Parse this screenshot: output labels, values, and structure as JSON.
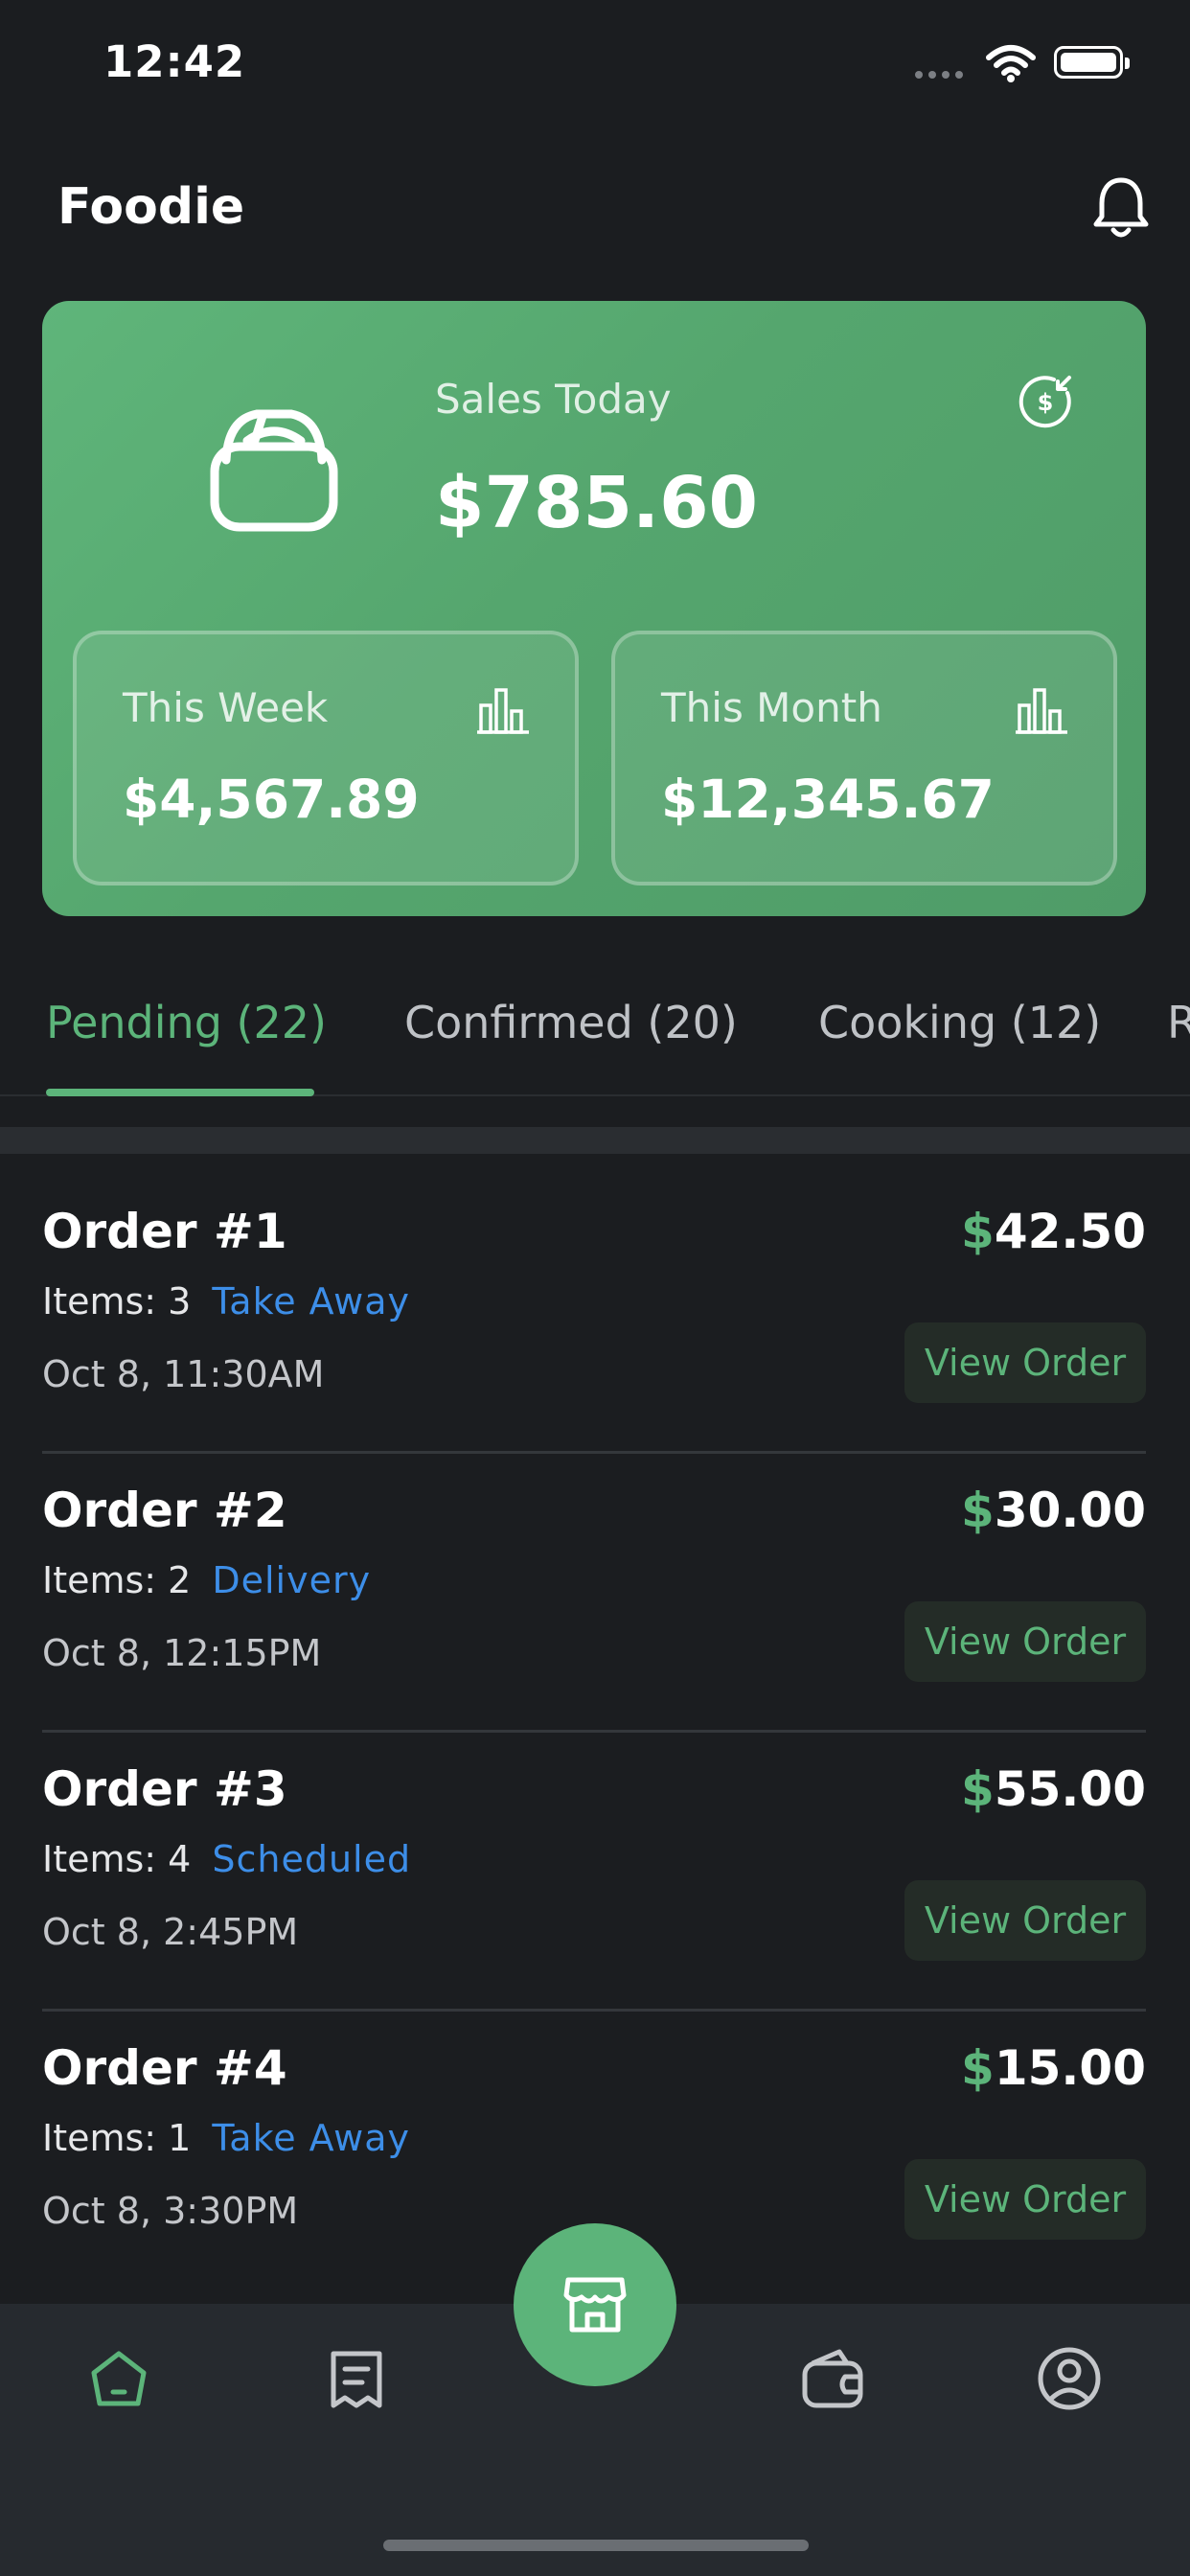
{
  "status_bar": {
    "time": "12:42"
  },
  "header": {
    "title": "Foodie"
  },
  "hero": {
    "sales_label": "Sales Today",
    "sales_value": "$785.60",
    "stats": [
      {
        "label": "This Week",
        "value": "$4,567.89"
      },
      {
        "label": "This Month",
        "value": "$12,345.67"
      }
    ]
  },
  "tabs": [
    {
      "label": "Pending (22)",
      "active": true
    },
    {
      "label": "Confirmed (20)"
    },
    {
      "label": "Cooking (12)"
    },
    {
      "label": "R"
    }
  ],
  "orders": [
    {
      "title": "Order #1",
      "currency": "$",
      "amount": "42.50",
      "items": "Items: 3",
      "type": "Take Away",
      "date": "Oct 8, 11:30AM",
      "button": "View Order"
    },
    {
      "title": "Order #2",
      "currency": "$",
      "amount": "30.00",
      "items": "Items: 2",
      "type": "Delivery",
      "date": "Oct 8, 12:15PM",
      "button": "View Order"
    },
    {
      "title": "Order #3",
      "currency": "$",
      "amount": "55.00",
      "items": "Items: 4",
      "type": "Scheduled",
      "date": "Oct 8, 2:45PM",
      "button": "View Order"
    },
    {
      "title": "Order #4",
      "currency": "$",
      "amount": "15.00",
      "items": "Items: 1",
      "type": "Take Away",
      "date": "Oct 8, 3:30PM",
      "button": "View Order"
    }
  ],
  "bottom_nav": [
    {
      "icon": "home-icon",
      "active": true
    },
    {
      "icon": "receipt-icon"
    },
    {
      "icon": "store-icon",
      "fab": true
    },
    {
      "icon": "wallet-icon"
    },
    {
      "icon": "profile-icon"
    }
  ],
  "colors": {
    "accent": "#5cb47a",
    "link": "#3d8ee8",
    "background": "#1b1d20",
    "nav_background": "#262a2f"
  }
}
